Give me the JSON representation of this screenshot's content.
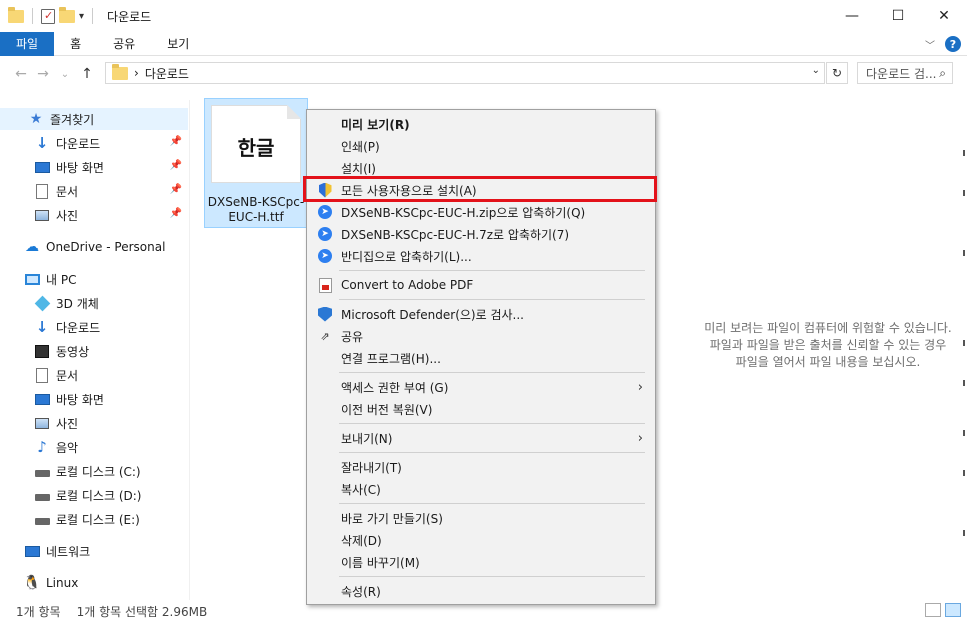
{
  "window": {
    "title": "다운로드",
    "controls": {
      "minimize": "—",
      "maximize": "☐",
      "close": "✕"
    }
  },
  "ribbon": {
    "tabs": [
      "파일",
      "홈",
      "공유",
      "보기"
    ],
    "help": "?"
  },
  "address": {
    "path_separator": "›",
    "path": "다운로드",
    "search_placeholder": "다운로드 검..."
  },
  "nav": {
    "quick_access": "즐겨찾기",
    "pinned": [
      "다운로드",
      "바탕 화면",
      "문서",
      "사진"
    ],
    "onedrive": "OneDrive - Personal",
    "this_pc": "내 PC",
    "pc_items": [
      "3D 개체",
      "다운로드",
      "동영상",
      "문서",
      "바탕 화면",
      "사진",
      "음악",
      "로컬 디스크 (C:)",
      "로컬 디스크 (D:)",
      "로컬 디스크 (E:)"
    ],
    "network": "네트워크",
    "linux": "Linux"
  },
  "file": {
    "icon_text": "한글",
    "name_line1": "DXSeNB-KSCpc-",
    "name_line2": "EUC-H.ttf"
  },
  "preview": {
    "line1": "미리 보려는 파일이 컴퓨터에 위험할 수 있습니다.",
    "line2": "파일과 파일을 받은 출처를 신뢰할 수 있는 경우",
    "line3": "파일을 열어서 파일 내용을 보십시오."
  },
  "status": {
    "count": "1개 항목",
    "selection": "1개 항목 선택함 2.96MB"
  },
  "context_menu": {
    "preview": "미리 보기(R)",
    "print": "인쇄(P)",
    "install": "설치(I)",
    "install_all": "모든 사용자용으로 설치(A)",
    "zip": "DXSeNB-KSCpc-EUC-H.zip으로 압축하기(Q)",
    "sevenz": "DXSeNB-KSCpc-EUC-H.7z로 압축하기(7)",
    "bandizip": "반디집으로 압축하기(L)...",
    "adobe": "Convert to Adobe PDF",
    "defender": "Microsoft Defender(으)로 검사...",
    "share": "공유",
    "open_with": "연결 프로그램(H)...",
    "access": "액세스 권한 부여 (G)",
    "restore": "이전 버전 복원(V)",
    "send_to": "보내기(N)",
    "cut": "잘라내기(T)",
    "copy": "복사(C)",
    "shortcut": "바로 가기 만들기(S)",
    "delete": "삭제(D)",
    "rename": "이름 바꾸기(M)",
    "properties": "속성(R)"
  },
  "colors": {
    "accent": "#1a6fc4",
    "highlight_border": "#e3121a",
    "selection_bg": "#cce8ff"
  }
}
